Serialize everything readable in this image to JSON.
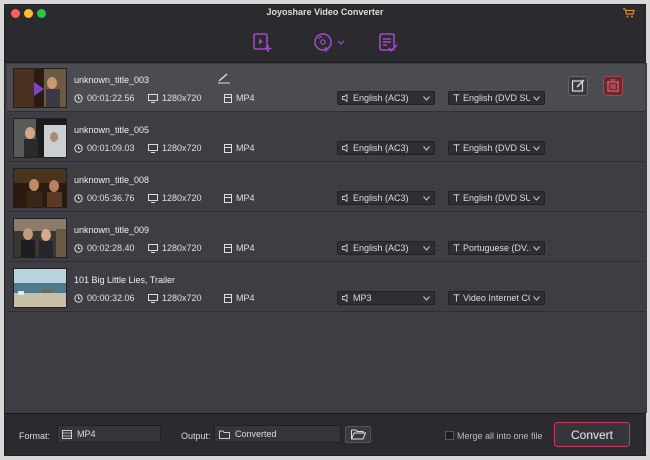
{
  "window": {
    "title": "Joyoshare Video Converter"
  },
  "toolbar": {
    "items": [
      "add-video",
      "add-dvd",
      "convert-list"
    ]
  },
  "files": [
    {
      "name": "unknown_title_003",
      "duration": "00:01:22.56",
      "resolution": "1280x720",
      "format": "MP4",
      "audio": "English (AC3)",
      "subtitle": "English (DVD SUB)"
    },
    {
      "name": "unknown_title_005",
      "duration": "00:01:09.03",
      "resolution": "1280x720",
      "format": "MP4",
      "audio": "English (AC3)",
      "subtitle": "English (DVD SUB)"
    },
    {
      "name": "unknown_title_008",
      "duration": "00:05:36.76",
      "resolution": "1280x720",
      "format": "MP4",
      "audio": "English (AC3)",
      "subtitle": "English (DVD SUB)"
    },
    {
      "name": "unknown_title_009",
      "duration": "00:02:28.40",
      "resolution": "1280x720",
      "format": "MP4",
      "audio": "English (AC3)",
      "subtitle": "Portuguese (DV..."
    },
    {
      "name": "101 Big Little Lies, Trailer",
      "duration": "00:00:32.06",
      "resolution": "1280x720",
      "format": "MP4",
      "audio": "MP3",
      "subtitle": "Video Internet CC"
    }
  ],
  "bottom": {
    "format_label": "Format:",
    "format_value": "MP4",
    "output_label": "Output:",
    "output_value": "Converted",
    "merge_label": "Merge all into one file",
    "convert_label": "Convert"
  },
  "colors": {
    "accent": "#a04ac8",
    "convert_border": "#c83a5a",
    "background": "#3d3d43"
  }
}
